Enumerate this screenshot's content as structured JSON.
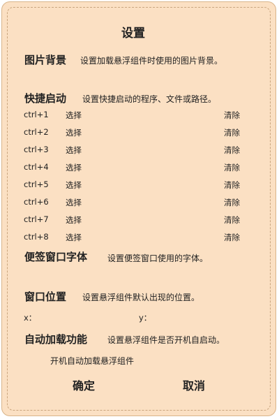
{
  "title": "设置",
  "background": {
    "label": "图片背景",
    "desc": "设置加载悬浮组件时使用的图片背景。"
  },
  "shortcuts": {
    "label": "快捷启动",
    "desc": "设置快捷启动的程序、文件或路径。",
    "rows": [
      {
        "key": "ctrl+1",
        "select": "选择",
        "clear": "清除"
      },
      {
        "key": "ctrl+2",
        "select": "选择",
        "clear": "清除"
      },
      {
        "key": "ctrl+3",
        "select": "选择",
        "clear": "清除"
      },
      {
        "key": "ctrl+4",
        "select": "选择",
        "clear": "清除"
      },
      {
        "key": "ctrl+5",
        "select": "选择",
        "clear": "清除"
      },
      {
        "key": "ctrl+6",
        "select": "选择",
        "clear": "清除"
      },
      {
        "key": "ctrl+7",
        "select": "选择",
        "clear": "清除"
      },
      {
        "key": "ctrl+8",
        "select": "选择",
        "clear": "清除"
      }
    ]
  },
  "font": {
    "label": "便签窗口字体",
    "desc": "设置便签窗口使用的字体。"
  },
  "position": {
    "label": "窗口位置",
    "desc": "设置悬浮组件默认出现的位置。",
    "x_label": "x：",
    "y_label": "y："
  },
  "autoload": {
    "label": "自动加载功能",
    "desc": "设置悬浮组件是否开机自启动。",
    "option": "开机自动加载悬浮组件"
  },
  "buttons": {
    "ok": "确定",
    "cancel": "取消"
  }
}
